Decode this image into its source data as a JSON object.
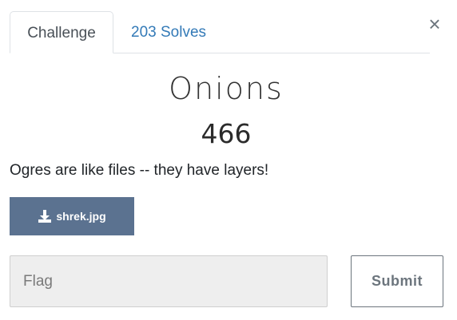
{
  "tabs": {
    "challenge_label": "Challenge",
    "solves_label": "203 Solves"
  },
  "close": {
    "glyph": "×",
    "icon": "close-icon"
  },
  "challenge": {
    "name": "Onions",
    "value": "466",
    "description": "Ogres are like files -- they have layers!"
  },
  "file": {
    "name": "shrek.jpg",
    "icon": "download-icon"
  },
  "form": {
    "flag_placeholder": "Flag",
    "flag_value": "",
    "submit_label": "Submit"
  },
  "colors": {
    "link": "#337ab7",
    "file_button_bg": "#5b7290",
    "input_bg": "#eeeeee",
    "submit_border": "#6c757d"
  }
}
